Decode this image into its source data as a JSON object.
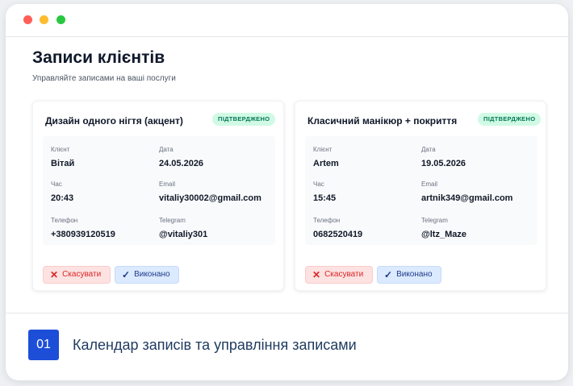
{
  "page": {
    "title": "Записи клієнтів",
    "subtitle": "Управляйте записами на ваші послуги"
  },
  "bookings": [
    {
      "service": "Дизайн одного нігтя (акцент)",
      "status": "ПІДТВЕРДЖЕНО",
      "fields": {
        "client_label": "Клієнт",
        "client": "Вітай",
        "date_label": "Дата",
        "date": "24.05.2026",
        "time_label": "Час",
        "time": "20:43",
        "email_label": "Email",
        "email": "vitaliy30002@gmail.com",
        "phone_label": "Телефон",
        "phone": "+380939120519",
        "telegram_label": "Telegram",
        "telegram": "@vitaliy301"
      },
      "cancel_label": "Скасувати",
      "done_label": "Виконано"
    },
    {
      "service": "Класичний манікюр + покриття",
      "status": "ПІДТВЕРДЖЕНО",
      "fields": {
        "client_label": "Клієнт",
        "client": "Artem",
        "date_label": "Дата",
        "date": "19.05.2026",
        "time_label": "Час",
        "time": "15:45",
        "email_label": "Email",
        "email": "artnik349@gmail.com",
        "phone_label": "Телефон",
        "phone": "0682520419",
        "telegram_label": "Telegram",
        "telegram": "@ltz_Maze"
      },
      "cancel_label": "Скасувати",
      "done_label": "Виконано"
    }
  ],
  "icons": {
    "cancel": "x-icon",
    "done": "check-icon"
  },
  "colors": {
    "accent": "#1d4ed8",
    "status_bg": "#d1fae5",
    "status_text": "#047857",
    "cancel": "#dc2626"
  },
  "footer": {
    "step_number": "01",
    "step_text": "Календар записів та управління записами"
  }
}
